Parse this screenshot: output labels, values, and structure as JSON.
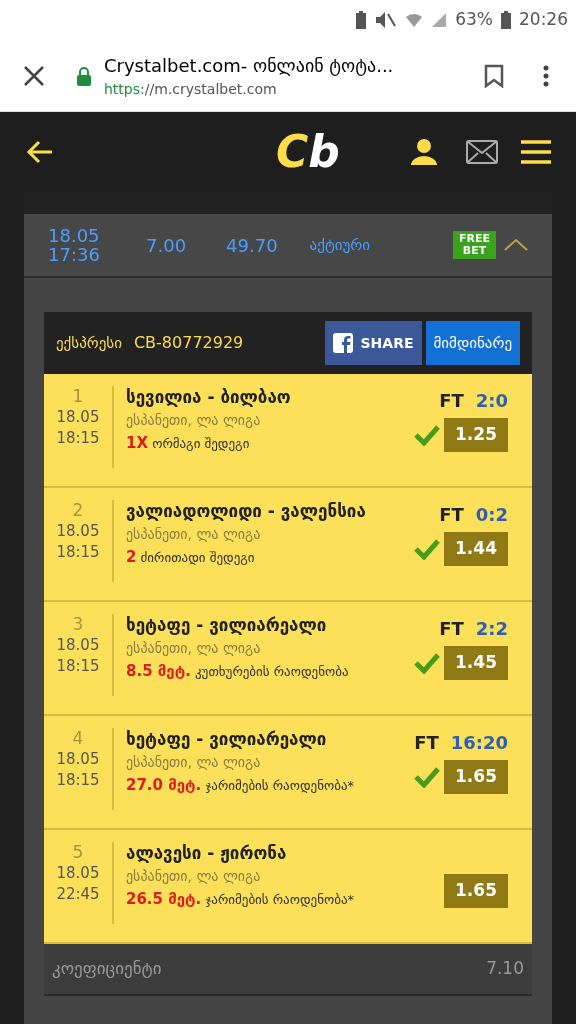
{
  "status_bar": {
    "battery": "63%",
    "time": "20:26"
  },
  "browser": {
    "title": "Crystalbet.com- ონლაინ ტოტა...",
    "url_scheme": "https",
    "url_rest": "://m.crystalbet.com"
  },
  "header": {
    "logo_c": "C",
    "logo_b": "b"
  },
  "bet": {
    "date": "18.05",
    "time": "17:36",
    "stake": "7.00",
    "payout": "49.70",
    "status": "აქტიური",
    "free_bet_1": "FREE",
    "free_bet_2": "BET",
    "expanded": true
  },
  "ticket": {
    "type": "ექსპრესი",
    "code": "CB-80772929",
    "share": "SHARE",
    "current": "მიმდინარე"
  },
  "events": [
    {
      "number": "1",
      "date": "18.05",
      "time": "18:15",
      "match": "სევილია - ბილბაო",
      "league": "ესპანეთი, ლა ლიგა",
      "pick": "1X",
      "market": "ორმაგი შედეგი",
      "status": "FT",
      "score": "2:0",
      "won": true,
      "odds": "1.25"
    },
    {
      "number": "2",
      "date": "18.05",
      "time": "18:15",
      "match": "ვალიადოლიდი - ვალენსია",
      "league": "ესპანეთი, ლა ლიგა",
      "pick": "2",
      "market": "ძირითადი შედეგი",
      "status": "FT",
      "score": "0:2",
      "won": true,
      "odds": "1.44"
    },
    {
      "number": "3",
      "date": "18.05",
      "time": "18:15",
      "match": "ხეტაფე - ვილიარეალი",
      "league": "ესპანეთი, ლა ლიგა",
      "pick": "8.5 მეტ.",
      "market": "კუთხურების რაოდენობა",
      "status": "FT",
      "score": "2:2",
      "won": true,
      "odds": "1.45"
    },
    {
      "number": "4",
      "date": "18.05",
      "time": "18:15",
      "match": "ხეტაფე - ვილიარეალი",
      "league": "ესპანეთი, ლა ლიგა",
      "pick": "27.0 მეტ.",
      "market": "ჯარიმების რაოდენობა*",
      "status": "FT",
      "score": "16:20",
      "won": true,
      "odds": "1.65"
    },
    {
      "number": "5",
      "date": "18.05",
      "time": "22:45",
      "match": "ალავესი - ჟირონა",
      "league": "ესპანეთი, ლა ლიგა",
      "pick": "26.5 მეტ.",
      "market": "ჯარიმების რაოდენობა*",
      "won": false,
      "odds": "1.65"
    }
  ],
  "summary": [
    {
      "label": "კოეფიციენტი",
      "value": "7.10"
    }
  ]
}
